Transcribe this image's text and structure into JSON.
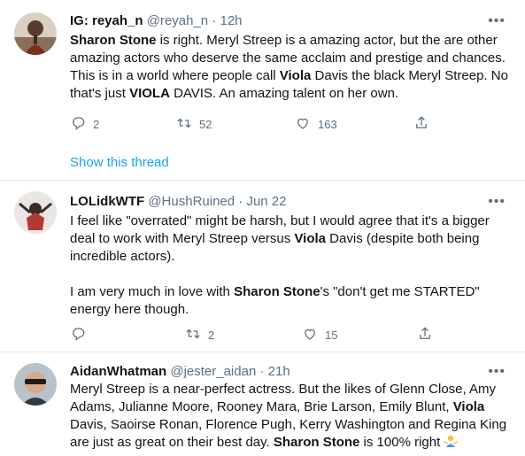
{
  "tweets": [
    {
      "name": "IG: reyah_n",
      "handle": "@reyah_n",
      "separator": "·",
      "time": "12h",
      "more": "•••",
      "body_parts": [
        {
          "b": "Sharon Stone"
        },
        {
          "t": " is right. Meryl Streep is a amazing actor, but the are other amazing actors who deserve the same acclaim and prestige and chances. This is in a world where people call "
        },
        {
          "b": "Viola"
        },
        {
          "t": " Davis the black Meryl Streep. No that's just "
        },
        {
          "b": "VIOLA"
        },
        {
          "t": " DAVIS. An amazing talent on her own."
        }
      ],
      "replies": "2",
      "retweets": "52",
      "likes": "163",
      "show_thread": "Show this thread"
    },
    {
      "name": "LOLidkWTF",
      "handle": "@HushRuined",
      "separator": "·",
      "time": "Jun 22",
      "more": "•••",
      "body_p1_parts": [
        {
          "t": "I feel like \"overrated\" might be harsh, but I would agree that it's a bigger deal to work with Meryl Streep versus "
        },
        {
          "b": "Viola"
        },
        {
          "t": " Davis (despite both being incredible actors)."
        }
      ],
      "body_p2_parts": [
        {
          "t": "I am very much in love with "
        },
        {
          "b": "Sharon Stone"
        },
        {
          "t": "'s \"don't get me STARTED\" energy here though."
        }
      ],
      "replies": "",
      "retweets": "2",
      "likes": "15"
    },
    {
      "name": "AidanWhatman",
      "handle": "@jester_aidan",
      "separator": "·",
      "time": "21h",
      "more": "•••",
      "body_parts": [
        {
          "t": "Meryl Streep is a near-perfect actress. But the likes of Glenn Close, Amy Adams, Julianne Moore, Rooney Mara, Brie Larson, Emily Blunt, "
        },
        {
          "b": "Viola"
        },
        {
          "t": " Davis, Saoirse Ronan, Florence Pugh, Kerry Washington and Regina King are just as great on their best day. "
        },
        {
          "b": "Sharon Stone"
        },
        {
          "t": " is 100% right "
        }
      ],
      "emoji": "person-shrugging-emoji"
    }
  ],
  "colors": {
    "text": "#0f1419",
    "muted": "#5b7083",
    "link": "#1da1f2",
    "divider": "#e1e8ed"
  }
}
